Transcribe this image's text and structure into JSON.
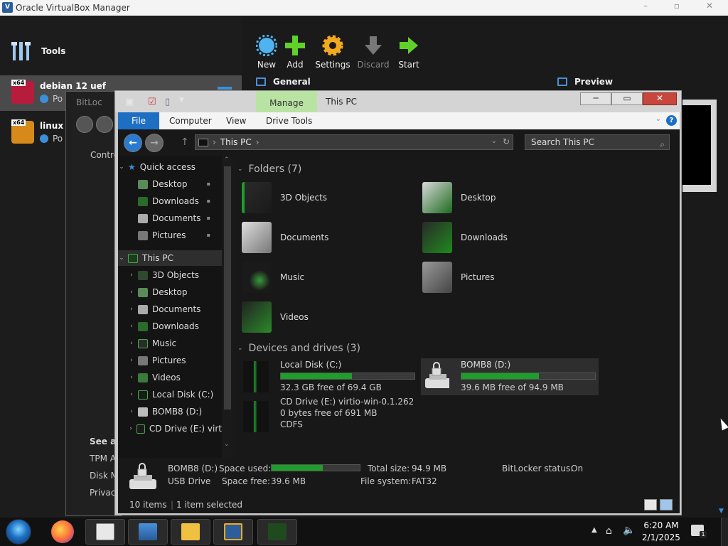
{
  "vbox": {
    "title": "Oracle VirtualBox Manager",
    "tools_label": "Tools",
    "vms": [
      {
        "name": "debian 12 uef",
        "state": "Po",
        "arch": "x64"
      },
      {
        "name": "linux n",
        "state": "Po",
        "arch": "x64"
      }
    ],
    "toolbar": [
      "New",
      "Add",
      "Settings",
      "Discard",
      "Start"
    ],
    "general_label": "General",
    "preview_label": "Preview"
  },
  "bitlocker": {
    "title": "BitLoc",
    "control_panel": "Contro",
    "see_also": "See als",
    "links": [
      "TPM A",
      "Disk M",
      "Privac"
    ]
  },
  "explorer": {
    "title": "This PC",
    "manage_tab": "Manage",
    "ribbon_tabs": [
      "File",
      "Computer",
      "View",
      "Drive Tools"
    ],
    "address": "This PC",
    "search_placeholder": "Search This PC",
    "nav": {
      "quick_access": "Quick access",
      "quick_items": [
        "Desktop",
        "Downloads",
        "Documents",
        "Pictures"
      ],
      "this_pc": "This PC",
      "pc_items": [
        "3D Objects",
        "Desktop",
        "Documents",
        "Downloads",
        "Music",
        "Pictures",
        "Videos",
        "Local Disk (C:)",
        "BOMB8 (D:)",
        "CD Drive (E:) virt"
      ]
    },
    "folders_header": "Folders (7)",
    "folders": [
      "3D Objects",
      "Desktop",
      "Documents",
      "Downloads",
      "Music",
      "Pictures",
      "Videos"
    ],
    "devices_header": "Devices and drives (3)",
    "drives": [
      {
        "name": "Local Disk (C:)",
        "free": "32.3 GB free of 69.4 GB",
        "used_fraction": 0.53
      },
      {
        "name": "BOMB8 (D:)",
        "free": "39.6 MB free of 94.9 MB",
        "used_fraction": 0.58
      }
    ],
    "cd_drive": {
      "name": "CD Drive (E:) virtio-win-0.1.262",
      "free": "0 bytes free of 691 MB",
      "fs": "CDFS"
    },
    "details": {
      "name": "BOMB8 (D:)",
      "type": "USB Drive",
      "space_used_label": "Space used:",
      "space_free_label": "Space free:",
      "space_free": "39.6 MB",
      "total_size_label": "Total size:",
      "total_size": "94.9 MB",
      "file_system_label": "File system:",
      "file_system": "FAT32",
      "bitlocker_label": "BitLocker status:",
      "bitlocker": "On",
      "used_fraction": 0.58
    },
    "status": {
      "items": "10 items",
      "selected": "1 item selected"
    }
  },
  "taskbar": {
    "time": "6:20 AM",
    "date": "2/1/2025",
    "notifications": "1"
  },
  "colors": {
    "accent": "#1e6fc4",
    "drive_fill": "#1e9e2a",
    "manage_tab": "#b9e3a3"
  }
}
